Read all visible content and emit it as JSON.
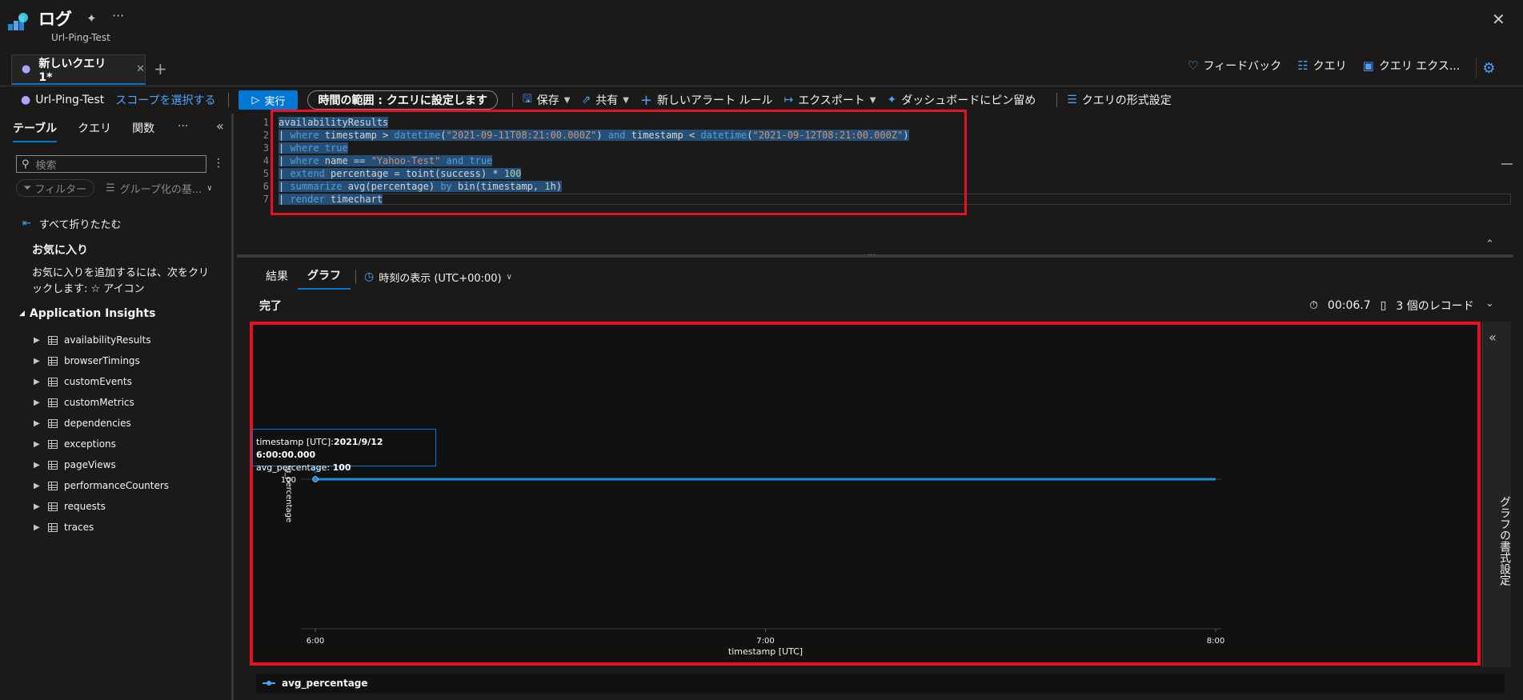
{
  "header": {
    "title": "ログ",
    "subtitle": "Url-Ping-Test"
  },
  "tabs": {
    "active_label": "新しいクエリ 1*",
    "add": "+",
    "right_actions": [
      {
        "label": "フィードバック",
        "icon": "heart-icon"
      },
      {
        "label": "クエリ",
        "icon": "queries-icon"
      },
      {
        "label": "クエリ エクス...",
        "icon": "query-explorer-icon"
      }
    ]
  },
  "toolbar": {
    "resource": "Url-Ping-Test",
    "select_scope": "スコープを選択する",
    "run": "実行",
    "time_range": "時間の範囲 : クエリに設定します",
    "save": "保存",
    "share": "共有",
    "new_alert": "新しいアラート ルール",
    "export": "エクスポート",
    "pin": "ダッシュボードにピン留め",
    "format": "クエリの形式設定"
  },
  "left_panel": {
    "tabs": [
      "テーブル",
      "クエリ",
      "関数"
    ],
    "more": "···",
    "search_placeholder": "検索",
    "filter": "フィルター",
    "group_by": "グループ化の基...",
    "collapse_all": "すべて折りたたむ",
    "favorites_title": "お気に入り",
    "favorites_hint": "お気に入りを追加するには、次をクリックします: ☆ アイコン",
    "section": "Application Insights",
    "tables": [
      "availabilityResults",
      "browserTimings",
      "customEvents",
      "customMetrics",
      "dependencies",
      "exceptions",
      "pageViews",
      "performanceCounters",
      "requests",
      "traces"
    ]
  },
  "editor": {
    "line_numbers": [
      "1",
      "2",
      "3",
      "4",
      "5",
      "6",
      "7"
    ]
  },
  "results": {
    "tabs": [
      "結果",
      "グラフ"
    ],
    "timezone": "時刻の表示 (UTC+00:00)",
    "status": "完了",
    "duration": "00:06.7",
    "records": "3 個のレコード"
  },
  "chart_side": {
    "label": "グラフの書式設定"
  },
  "tooltip": {
    "ts_label": "timestamp [UTC]:",
    "ts_value": "2021/9/12 6:00:00.000",
    "val_label": "avg_percentage:",
    "val_value": "100"
  },
  "chart_data": {
    "type": "line",
    "xlabel": "timestamp [UTC]",
    "ylabel": "avg_percentage",
    "x": [
      "6:00",
      "7:00",
      "8:00"
    ],
    "series": [
      {
        "name": "avg_percentage",
        "values": [
          100,
          100,
          100
        ]
      }
    ],
    "yticks": [
      "100"
    ],
    "color": "#1f8ad6"
  },
  "colors": {
    "accent": "#0078d4",
    "highlight_box": "#e81123"
  }
}
